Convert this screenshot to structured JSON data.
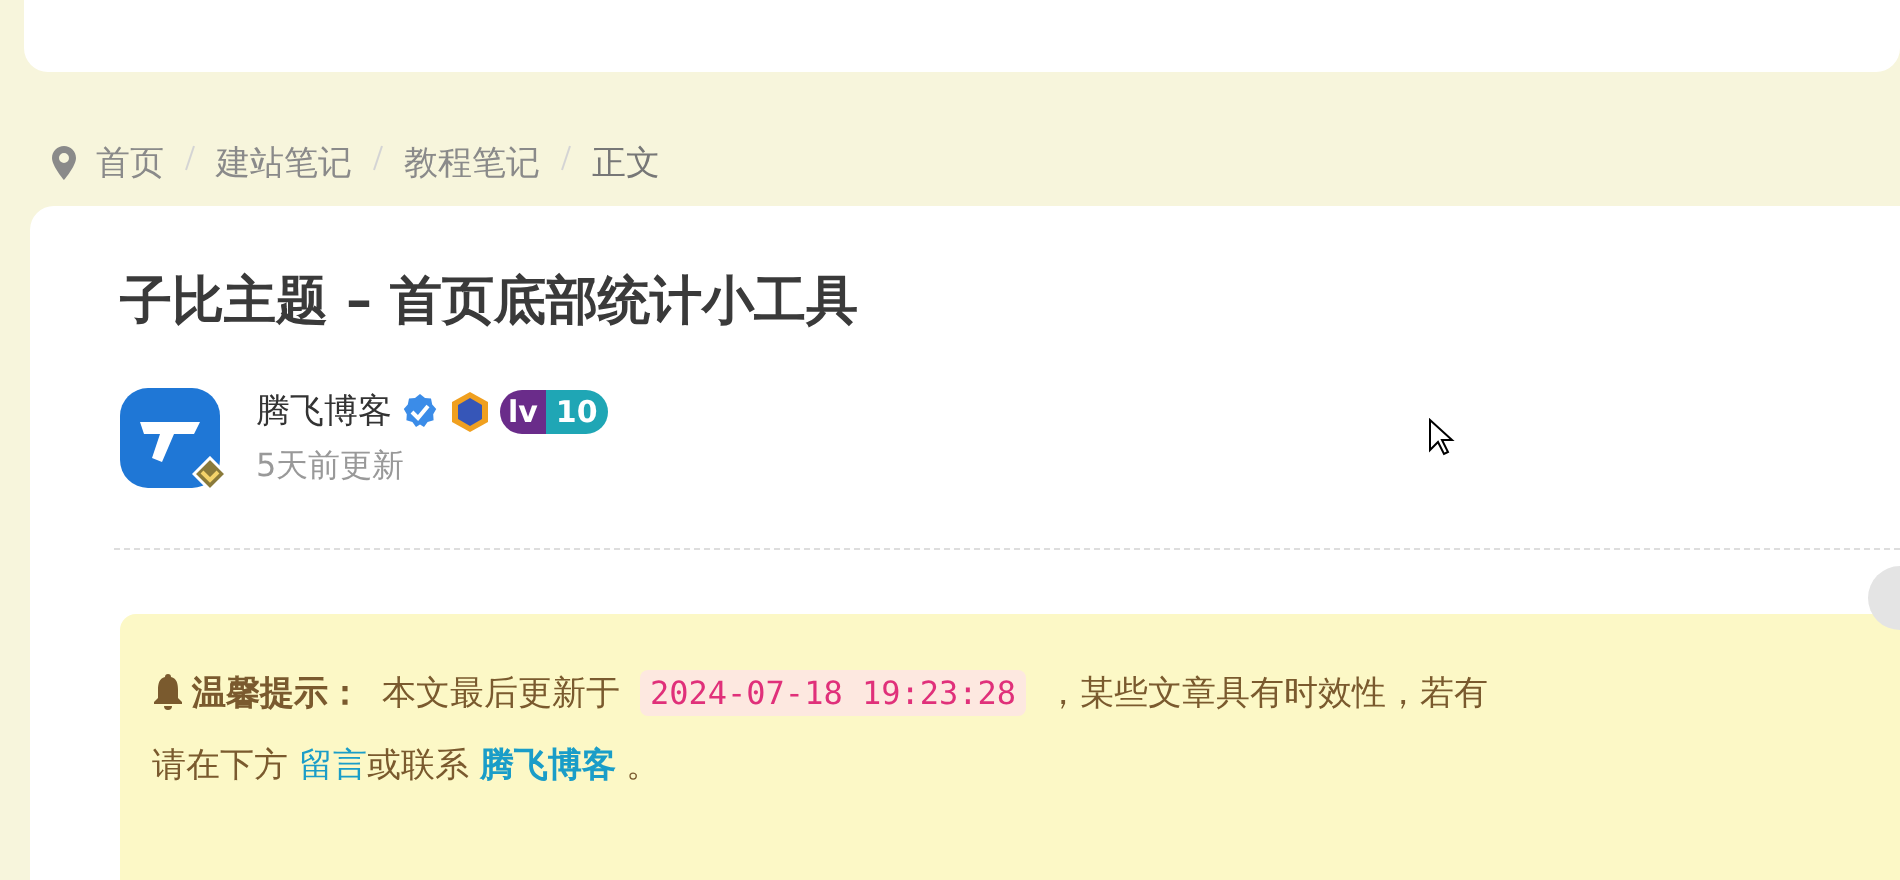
{
  "breadcrumb": [
    {
      "label": "首页",
      "kind": "home"
    },
    {
      "label": "建站笔记",
      "kind": "link"
    },
    {
      "label": "教程笔记",
      "kind": "link"
    },
    {
      "label": "正文",
      "kind": "current"
    }
  ],
  "article": {
    "title": "子比主题 – 首页底部统计小工具",
    "author": {
      "name": "腾飞博客",
      "verified": true,
      "level_prefix": "lv",
      "level": "10",
      "updated": "5天前更新"
    },
    "notice": {
      "label": "温馨提示：",
      "before": "本文最后更新于",
      "date": "2024-07-18 19:23:28",
      "after": "，某些文章具有时效性，若有",
      "line2_before": "请在下方",
      "comment_link": "留言",
      "middle": "或联系",
      "author_link": "腾飞博客",
      "end": "。"
    }
  }
}
